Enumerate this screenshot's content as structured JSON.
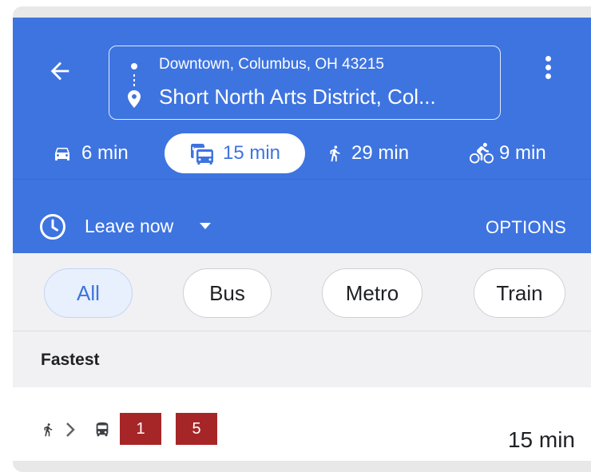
{
  "header": {
    "origin": "Downtown, Columbus, OH 43215",
    "destination": "Short North Arts District, Col...",
    "back_icon": "arrow-left-icon",
    "more_icon": "more-vert-icon"
  },
  "modes": [
    {
      "name": "drive",
      "icon": "car-icon",
      "label": "6 min",
      "selected": false
    },
    {
      "name": "transit",
      "icon": "transit-icon",
      "label": "15 min",
      "selected": true
    },
    {
      "name": "walk",
      "icon": "walk-icon",
      "label": "29 min",
      "selected": false
    },
    {
      "name": "bike",
      "icon": "bike-icon",
      "label": "9 min",
      "selected": false
    }
  ],
  "time_bar": {
    "leave_label": "Leave now",
    "options_label": "OPTIONS"
  },
  "filters": {
    "chips": [
      {
        "label": "All",
        "selected": true
      },
      {
        "label": "Bus",
        "selected": false
      },
      {
        "label": "Metro",
        "selected": false
      },
      {
        "label": "Train",
        "selected": false
      }
    ]
  },
  "results": {
    "section_title": "Fastest",
    "routes": [
      {
        "steps": [
          "walk-icon",
          "chevron-right-icon",
          "bus-icon"
        ],
        "lines": [
          "1",
          "5"
        ],
        "duration": "15 min"
      }
    ]
  },
  "colors": {
    "header_blue": "#3e74e0",
    "line_badge": "#a62628",
    "chip_active_bg": "#e8f0fd"
  }
}
